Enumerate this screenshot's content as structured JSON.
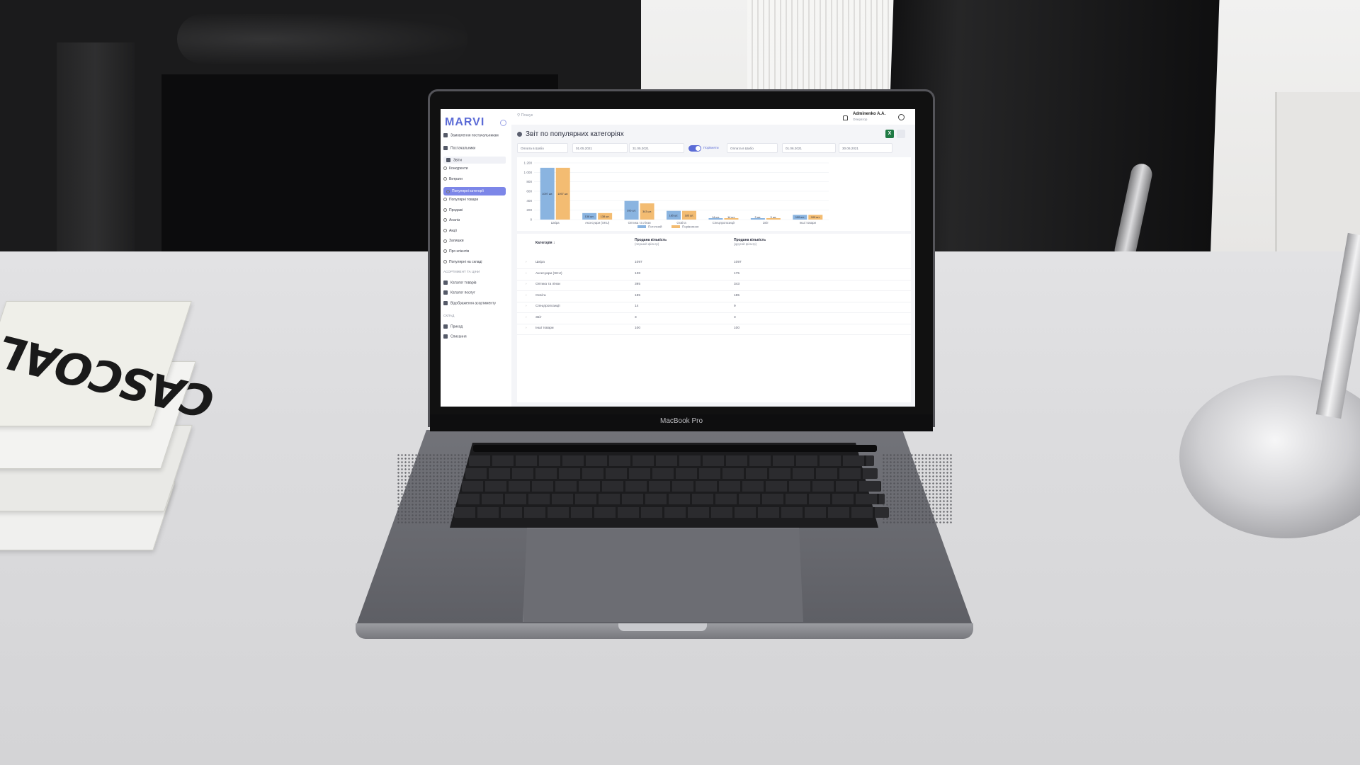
{
  "app": {
    "logo": "MARVI",
    "search_placeholder": "Пошук",
    "user_name": "Adminenko A.A.",
    "user_role": "Оператор"
  },
  "laptop": {
    "model_label": "MacBook Pro"
  },
  "sidebar": {
    "items": [
      {
        "label": "Замовлення постачальникам",
        "type": "main",
        "icon": "box-icon"
      },
      {
        "label": "Постачальники",
        "type": "main",
        "icon": "user-icon"
      },
      {
        "label": "Звіти",
        "type": "group",
        "icon": "chart-pie-icon"
      },
      {
        "label": "Конкуренти",
        "type": "sub"
      },
      {
        "label": "Витрати",
        "type": "sub"
      },
      {
        "label": "Популярні категорії",
        "type": "active"
      },
      {
        "label": "Популярні товари",
        "type": "sub"
      },
      {
        "label": "Продажі",
        "type": "sub"
      },
      {
        "label": "Аналіз",
        "type": "sub"
      },
      {
        "label": "Акції",
        "type": "sub"
      },
      {
        "label": "Залишки",
        "type": "sub"
      },
      {
        "label": "Про клієнтів",
        "type": "sub"
      },
      {
        "label": "Популярні на складі",
        "type": "sub"
      },
      {
        "label": "АСОРТИМЕНТ ТА ЦІНИ",
        "type": "section"
      },
      {
        "label": "Каталог товарів",
        "type": "main",
        "icon": "catalog-icon"
      },
      {
        "label": "Каталог послуг",
        "type": "main",
        "icon": "services-icon"
      },
      {
        "label": "Відображення асортименту",
        "type": "main",
        "icon": "display-icon"
      },
      {
        "label": "СКЛАД",
        "type": "section"
      },
      {
        "label": "Приход",
        "type": "main",
        "icon": "folder-icon"
      },
      {
        "label": "Списання",
        "type": "main",
        "icon": "folder-icon"
      }
    ]
  },
  "page": {
    "title": "Звіт по популярних категоріях",
    "excel_label": "X",
    "filters": {
      "sort_select": "Оплата в Шабо",
      "date_from": "01.05.2021",
      "date_to": "31.05.2021",
      "toggle_label": "Порівняти",
      "compare_select": "Оплата в Шабо",
      "compare_from": "01.06.2021",
      "compare_to": "30.06.2021"
    }
  },
  "chart_data": {
    "type": "bar",
    "categories": [
      "Шкіра",
      "Аксесуари (SKU)",
      "Оптика та лінзи",
      "Освіта",
      "Спецпропозиції",
      "Звіт",
      "Інші товари"
    ],
    "series": [
      {
        "name": "Поточний",
        "color": "#8ab4e0",
        "values": [
          1097,
          138,
          395,
          185,
          14,
          3,
          100
        ]
      },
      {
        "name": "Порівняння",
        "color": "#f3bc72",
        "values": [
          1097,
          138,
          343,
          185,
          14,
          3,
          100
        ]
      }
    ],
    "data_labels": [
      [
        "1097 шт.",
        "1097 шт."
      ],
      [
        "138 шт.",
        "138 шт."
      ],
      [
        "395 шт.",
        "343 шт."
      ],
      [
        "185 шт.",
        "185 шт."
      ],
      [
        "14 шт.",
        "14 шт."
      ],
      [
        "3 шт.",
        "3 шт."
      ],
      [
        "100 шт.",
        "100 шт."
      ]
    ],
    "y_ticks": [
      "1 200",
      "1 000",
      "800",
      "600",
      "400",
      "200",
      "0"
    ],
    "ylim": [
      0,
      1200
    ],
    "grid": true,
    "legend_position": "bottom"
  },
  "table": {
    "headers": [
      {
        "title": "Категорія",
        "sub": ""
      },
      {
        "title": "Продана кількість",
        "sub": "(перший фільтр)"
      },
      {
        "title": "Продана кількість",
        "sub": "(другий фільтр)"
      }
    ],
    "rows": [
      [
        "Шкіра",
        "1097",
        "1097"
      ],
      [
        "Аксесуари (SKU)",
        "138",
        "175"
      ],
      [
        "Оптика та лінзи",
        "395",
        "343"
      ],
      [
        "Освіта",
        "185",
        "185"
      ],
      [
        "Спецпропозиції",
        "14",
        "9"
      ],
      [
        "Звіт",
        "3",
        "3"
      ],
      [
        "Інші товари",
        "100",
        "100"
      ]
    ]
  },
  "book_cover_text": "CASCOAL"
}
